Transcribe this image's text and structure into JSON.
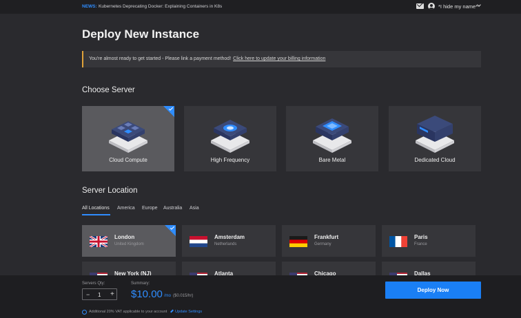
{
  "topbar": {
    "news_tag": "NEWS:",
    "news_text": "Kubernetes Deprecating Docker: Explaining Containers in K8s",
    "user_name": "*I hide my name*"
  },
  "page": {
    "title": "Deploy New Instance"
  },
  "alert": {
    "text": "You're almost ready to get started - Please link a payment method!",
    "link": "Click here to update your billing information"
  },
  "choose_server": {
    "title": "Choose Server",
    "items": [
      {
        "label": "Cloud Compute",
        "selected": true
      },
      {
        "label": "High Frequency",
        "selected": false
      },
      {
        "label": "Bare Metal",
        "selected": false
      },
      {
        "label": "Dedicated Cloud",
        "selected": false
      }
    ]
  },
  "location": {
    "title": "Server Location",
    "tabs": [
      "All Locations",
      "America",
      "Europe",
      "Australia",
      "Asia"
    ],
    "active_tab": "All Locations",
    "items": [
      {
        "city": "London",
        "country": "United Kingdom",
        "flag": "uk-flag",
        "selected": true
      },
      {
        "city": "Amsterdam",
        "country": "Netherlands",
        "flag": "netherlands-flag"
      },
      {
        "city": "Frankfurt",
        "country": "Germany",
        "flag": "germany-flag"
      },
      {
        "city": "Paris",
        "country": "France",
        "flag": "france-flag"
      },
      {
        "city": "New York (NJ)",
        "flag": "us-flag"
      },
      {
        "city": "Atlanta",
        "flag": "us-flag"
      },
      {
        "city": "Chicago",
        "flag": "us-flag"
      },
      {
        "city": "Dallas",
        "flag": "us-flag"
      }
    ]
  },
  "footer": {
    "qty_label": "Servers Qty:",
    "qty_minus": "−",
    "qty_value": "1",
    "qty_plus": "+",
    "summary_label": "Summary:",
    "price": "$10.00",
    "per": "/mo",
    "hourly": "($0.015/hr)",
    "vat_text": "Additional 20% VAT applicable to your account",
    "update_link": "Update Settings",
    "deploy_label": "Deploy Now"
  },
  "colors": {
    "accent": "#2f8dff",
    "alert_border": "#e0a33a",
    "background": "#2a2a2e",
    "card": "#36363a",
    "card_selected": "#5a5a5e"
  }
}
